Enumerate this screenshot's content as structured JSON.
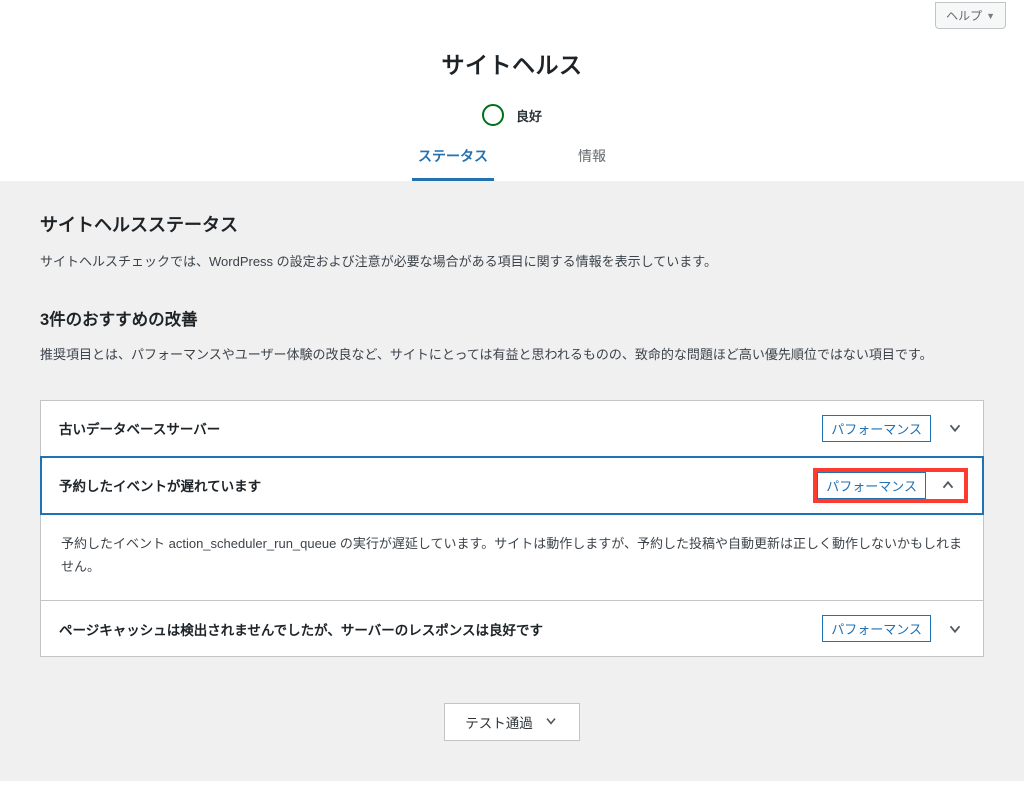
{
  "help": {
    "label": "ヘルプ"
  },
  "header": {
    "title": "サイトヘルス",
    "indicator_label": "良好"
  },
  "tabs": {
    "status": "ステータス",
    "info": "情報"
  },
  "status_section": {
    "title": "サイトヘルスステータス",
    "desc": "サイトヘルスチェックでは、WordPress の設定および注意が必要な場合がある項目に関する情報を表示しています。"
  },
  "recs": {
    "title": "3件のおすすめの改善",
    "desc": "推奨項目とは、パフォーマンスやユーザー体験の改良など、サイトにとっては有益と思われるものの、致命的な問題ほど高い優先順位ではない項目です。"
  },
  "items": [
    {
      "title": "古いデータベースサーバー",
      "badge": "パフォーマンス"
    },
    {
      "title": "予約したイベントが遅れています",
      "badge": "パフォーマンス",
      "detail": "予約したイベント action_scheduler_run_queue の実行が遅延しています。サイトは動作しますが、予約した投稿や自動更新は正しく動作しないかもしれません。"
    },
    {
      "title": "ページキャッシュは検出されませんでしたが、サーバーのレスポンスは良好です",
      "badge": "パフォーマンス"
    }
  ],
  "tests_passed": {
    "label": "テスト通過"
  }
}
